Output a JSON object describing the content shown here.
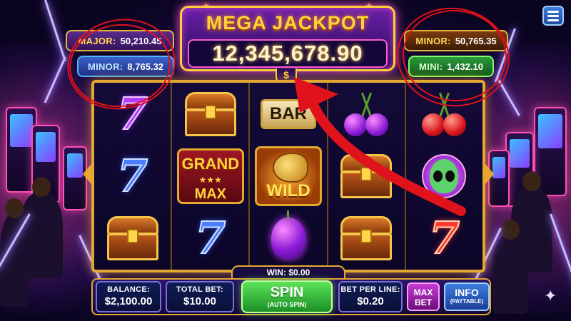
{
  "jackpots": {
    "mega_title": "MEGA JACKPOT",
    "mega_value": "12,345,678.90",
    "mega_currency": "$",
    "major_label": "MAJOR:",
    "major_value": "50,210.45",
    "minor_left_label": "MINOR:",
    "minor_left_value": "8,765.32",
    "minor_right_label": "MINOR:",
    "minor_right_value": "50,765.35",
    "mini_label": "MINI:",
    "mini_value": "1,432.10"
  },
  "reels": [
    [
      "seven-purple",
      "seven-blue",
      "chest"
    ],
    [
      "chest",
      "grand-max",
      "seven-blue"
    ],
    [
      "bar",
      "wild",
      "plum"
    ],
    [
      "cherries",
      "chest",
      "chest"
    ],
    [
      "cherries",
      "alien",
      "seven-red"
    ]
  ],
  "symbols": {
    "seven": "7",
    "bar": "BAR",
    "grand_top": "GRAND",
    "grand_stars": "★★★",
    "grand_bottom": "MAX",
    "wild": "WILD"
  },
  "bottom": {
    "win_label": "WIN:",
    "win_value": "$0.00",
    "balance_label": "BALANCE:",
    "balance_value": "$2,100.00",
    "total_bet_label": "TOTAL BET:",
    "total_bet_value": "$10.00",
    "spin_label": "SPIN",
    "spin_sub": "(AUTO SPIN)",
    "bet_line_label": "BET PER LINE:",
    "bet_line_value": "$0.20",
    "max_bet_label_1": "MAX",
    "max_bet_label_2": "BET",
    "info_label": "INFO",
    "info_sub": "(PAYTABLE)"
  },
  "colors": {
    "annotation_red": "#e0121b",
    "reel_frame_gold": "#e3a832",
    "spin_green": "#2fb537"
  },
  "icons": {
    "menu": "hamburger-menu-icon",
    "sparkle": "sparkle-icon"
  }
}
